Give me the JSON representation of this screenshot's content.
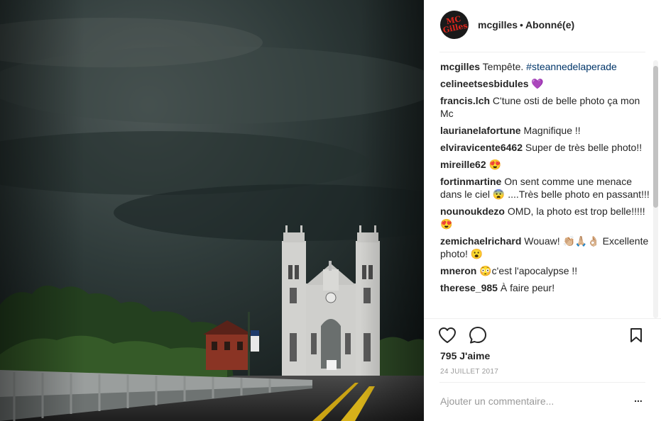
{
  "post": {
    "username": "mcgilles",
    "separator": "•",
    "follow_status": "Abonné(e)",
    "avatar_text": "MC Gilles",
    "photo_alt": "photo"
  },
  "comments": [
    {
      "user": "mcgilles",
      "text": "Tempête.",
      "tag": "#steannedelaperade",
      "emoji": ""
    },
    {
      "user": "celineetsesbidules",
      "text": "",
      "tag": "",
      "emoji": "💜"
    },
    {
      "user": "francis.lch",
      "text": "C'tune osti de belle photo ça mon Mc",
      "tag": "",
      "emoji": ""
    },
    {
      "user": "laurianelafortune",
      "text": "Magnifique !!",
      "tag": "",
      "emoji": ""
    },
    {
      "user": "elviravicente6462",
      "text": "Super de très belle photo!!",
      "tag": "",
      "emoji": ""
    },
    {
      "user": "mireille62",
      "text": "",
      "tag": "",
      "emoji": "😍"
    },
    {
      "user": "fortinmartine",
      "text": "On sent comme une menace dans le ciel 😨 ....Très belle photo en passant!!!",
      "tag": "",
      "emoji": ""
    },
    {
      "user": "nounoukdezo",
      "text": "OMD, la photo est trop belle!!!!!",
      "tag": "",
      "emoji": "😍"
    },
    {
      "user": "zemichaelrichard",
      "text": "Wouaw! 👏🏼🙏🏼👌🏼 Excellente photo!",
      "tag": "",
      "emoji": "😮"
    },
    {
      "user": "mneron",
      "text": "😳c'est l'apocalypse !!",
      "tag": "",
      "emoji": ""
    },
    {
      "user": "therese_985",
      "text": "À faire peur!",
      "tag": "",
      "emoji": ""
    }
  ],
  "actions": {
    "like_icon": "heart-outline-icon",
    "comment_icon": "speech-bubble-icon",
    "save_icon": "bookmark-icon"
  },
  "stats": {
    "likes": "795 J'aime",
    "date": "24 JUILLET 2017"
  },
  "composer": {
    "placeholder": "Ajouter un commentaire...",
    "more_label": "..."
  },
  "colors": {
    "hashtag": "#003569",
    "text": "#262626",
    "muted": "#999999",
    "avatar_brand": "#e0261c"
  }
}
